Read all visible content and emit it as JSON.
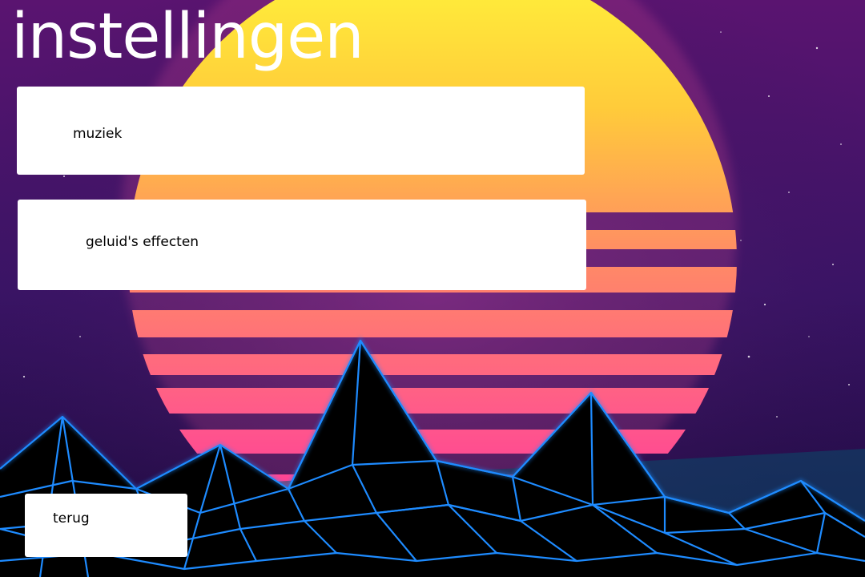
{
  "screen": {
    "title": "instellingen"
  },
  "menu": {
    "music_label": "muziek",
    "sfx_label": "geluid's effecten",
    "back_label": "terug"
  },
  "colors": {
    "sky_top": "#3a0f5e",
    "sky_bottom": "#1d0a3a",
    "sun_top": "#fff23a",
    "sun_mid": "#ff9a5a",
    "sun_bottom": "#ff2a9a",
    "grid_line": "#1e8bff",
    "mountain_fill": "#000000",
    "button_bg": "#ffffff",
    "title_text": "#ffffff"
  }
}
